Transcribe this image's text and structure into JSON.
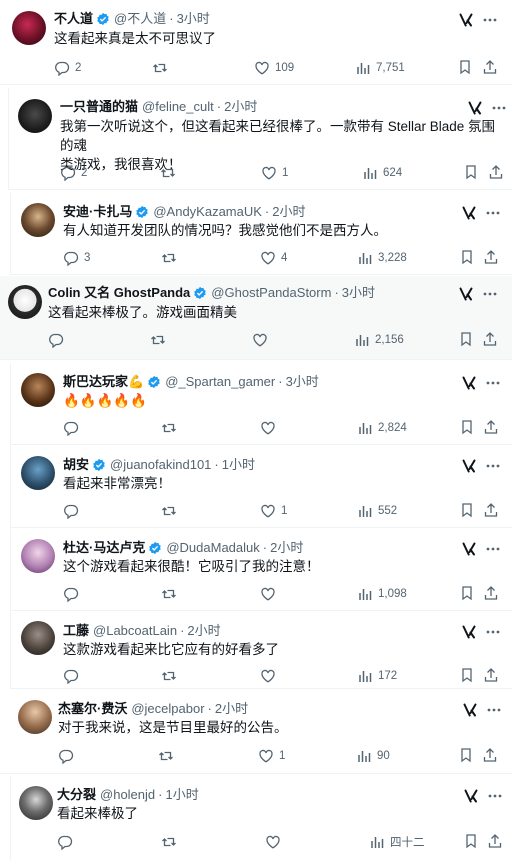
{
  "tweets": [
    {
      "name": "不人道",
      "verified": true,
      "handle": "@不人道",
      "time": "3小时",
      "text": "这看起来真是太不可思议了",
      "replies": "2",
      "retweets": "",
      "likes": "109",
      "views": "7,751"
    },
    {
      "name": "一只普通的猫",
      "verified": false,
      "handle": "@feline_cult",
      "time": "2小时",
      "text_line1": "我第一次听说这个，但这看起来已经很棒了。一款带有 Stellar Blade 氛围的魂",
      "text_line2": "类游戏，我很喜欢！",
      "replies": "2",
      "retweets": "",
      "likes": "1",
      "views": "624"
    },
    {
      "name": "安迪·卡扎马",
      "verified": true,
      "handle": "@AndyKazamaUK",
      "time": "2小时",
      "text": "有人知道开发团队的情况吗？我感觉他们不是西方人。",
      "replies": "3",
      "retweets": "",
      "likes": "4",
      "views": "3,228"
    },
    {
      "name": "Colin 又名 GhostPanda",
      "verified": true,
      "handle": "@GhostPandaStorm",
      "time": "3小时",
      "text": "这看起来棒极了。游戏画面精美",
      "replies": "",
      "retweets": "",
      "likes": "",
      "views": "2,156"
    },
    {
      "name": "斯巴达玩家💪",
      "verified": true,
      "handle": "@_Spartan_gamer",
      "time": "3小时",
      "text": "🔥🔥🔥🔥🔥",
      "replies": "",
      "retweets": "",
      "likes": "",
      "views": "2,824"
    },
    {
      "name": "胡安",
      "verified": true,
      "handle": "@juanofakind101",
      "time": "1小时",
      "text": "看起来非常漂亮！",
      "replies": "",
      "retweets": "",
      "likes": "1",
      "views": "552"
    },
    {
      "name": "杜达·马达卢克",
      "verified": true,
      "handle": "@DudaMadaluk",
      "time": "2小时",
      "text": "这个游戏看起来很酷！它吸引了我的注意！",
      "replies": "",
      "retweets": "",
      "likes": "",
      "views": "1,098"
    },
    {
      "name": "工藤",
      "verified": false,
      "handle": "@LabcoatLain",
      "time": "2小时",
      "text": "这款游戏看起来比它应有的好看多了",
      "replies": "",
      "retweets": "",
      "likes": "",
      "views": "172"
    },
    {
      "name": "杰塞尔·费沃",
      "verified": false,
      "handle": "@jecelpabor",
      "time": "2小时",
      "text": "对于我来说，这是节目里最好的公告。",
      "replies": "",
      "retweets": "",
      "likes": "1",
      "views": "90"
    },
    {
      "name": "大分裂",
      "verified": false,
      "handle": "@holenjd",
      "time": "1小时",
      "text": "看起来棒极了",
      "replies": "",
      "retweets": "",
      "likes": "",
      "views": "四十二"
    }
  ],
  "colors": {
    "text": "#0f1419",
    "muted": "#536471",
    "verified": "#1d9bf0",
    "divider": "#eff3f4"
  },
  "icons": [
    "reply-icon",
    "retweet-icon",
    "like-icon",
    "views-icon",
    "bookmark-icon",
    "share-icon",
    "grok-icon",
    "more-icon",
    "verified-icon"
  ]
}
